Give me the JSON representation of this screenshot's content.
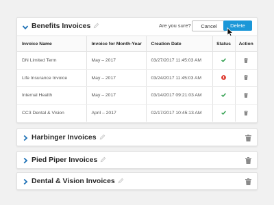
{
  "colors": {
    "accent": "#1b97d8",
    "success": "#2e9e4c",
    "error": "#e0463d",
    "chevron": "#1a6fb5",
    "icon_gray": "#8a8a8a"
  },
  "benefits": {
    "title": "Benefits Invoices",
    "confirm_text": "Are you sure?",
    "cancel_label": "Cancel",
    "delete_label": "Delete",
    "columns": [
      "Invoice Name",
      "Invoice for Month-Year",
      "Creation Date",
      "Status",
      "Action"
    ],
    "rows": [
      {
        "name": "DN Limited Term",
        "month": "May – 2017",
        "date": "03/27/2017 11:45:03 AM",
        "status": "success"
      },
      {
        "name": "Life Insurance Invoice",
        "month": "May – 2017",
        "date": "03/24/2017 11:45:03 AM",
        "status": "error"
      },
      {
        "name": "Internal Health",
        "month": "May – 2017",
        "date": "03/14/2017 09:21:03 AM",
        "status": "success"
      },
      {
        "name": "CC3 Dental & Vision",
        "month": "April – 2017",
        "date": "02/17/2017 10:45:13 AM",
        "status": "success"
      }
    ]
  },
  "collapsed_panels": [
    {
      "title": "Harbinger Invoices"
    },
    {
      "title": "Pied Piper Invoices"
    },
    {
      "title": "Dental & Vision Invoices"
    }
  ]
}
